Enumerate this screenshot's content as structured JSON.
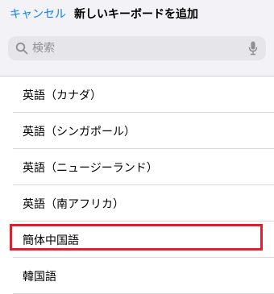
{
  "nav": {
    "cancel_label": "キャンセル",
    "title": "新しいキーボードを追加"
  },
  "search": {
    "placeholder": "検索",
    "value": ""
  },
  "keyboards": [
    {
      "label": "英語（カナダ）"
    },
    {
      "label": "英語（シンガポール）"
    },
    {
      "label": "英語（ニュージーランド）"
    },
    {
      "label": "英語（南アフリカ）"
    },
    {
      "label": "簡体中国語",
      "highlighted": true
    },
    {
      "label": "韓国語"
    }
  ],
  "colors": {
    "accent": "#0a84ff",
    "highlight": "#e2202c",
    "background": "#f2f2f7"
  },
  "icons": {
    "search": "magnifying-glass",
    "dictation": "microphone"
  }
}
